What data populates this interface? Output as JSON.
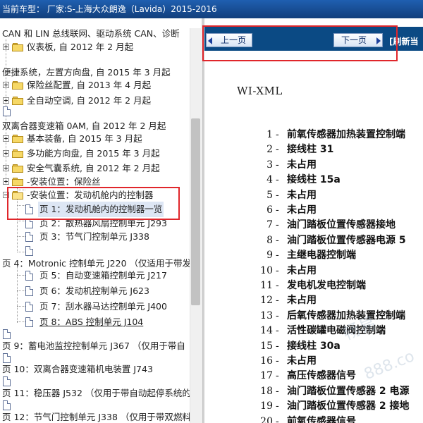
{
  "window": {
    "title": "当前车型：  厂家:S-上海大众朗逸（Lavida）2015-2016"
  },
  "tree": {
    "items": [
      {
        "label": "CAN 和 LIN 总线联网、驱动系统 CAN、诊断"
      },
      {
        "label": "仪表板, 自 2012 年 2 月起"
      },
      {
        "label": "便捷系统，左置方向盘, 自 2015 年 3 月起"
      },
      {
        "label": "保险丝配置, 自 2013 年 4 月起"
      },
      {
        "label": "全自动空调, 自 2012 年 2 月起"
      },
      {
        "label": ""
      },
      {
        "label": "双离合器变速箱 0AM, 自 2012 年 2 月起"
      },
      {
        "label": "基本装备, 自 2015 年 3 月起"
      },
      {
        "label": "多功能方向盘, 自 2015 年 3 月起"
      },
      {
        "label": "安全气囊系统, 自 2012 年 2 月起"
      },
      {
        "label": "-安装位置：保险丝"
      },
      {
        "label": "-安装位置：发动机舱内的控制器"
      },
      {
        "label": "页 1：发动机舱内的控制器一览"
      },
      {
        "label": "页 2：散热器风扇控制单元 J293"
      },
      {
        "label": "页 3：节气门控制单元 J338"
      },
      {
        "label": ""
      },
      {
        "label": "页 4：Motronic 控制单元 J220 （仅适用于带发"
      },
      {
        "label": "页 5：自动变速箱控制单元 J217"
      },
      {
        "label": "页 6：发动机控制单元 J623"
      },
      {
        "label": "页 7：刮水器马达控制单元 J400"
      },
      {
        "label": "页 8：ABS 控制单元 J104"
      },
      {
        "label": ""
      },
      {
        "label": "页 9：蓄电池监控控制单元 J367 （仅用于带自"
      },
      {
        "label": ""
      },
      {
        "label": "页 10：双离合器变速箱机电装置 J743"
      },
      {
        "label": ""
      },
      {
        "label": "页 11：稳压器 J532 （仅用于带自动起停系统的"
      },
      {
        "label": ""
      },
      {
        "label": "页 12：节气门控制单元 J338 （仅用于带双燃料"
      }
    ]
  },
  "nav": {
    "prev_label": "上一页",
    "next_label": "下一页",
    "refresh_label": "[刷新当"
  },
  "document": {
    "title": "WI-XML",
    "pins": [
      {
        "num": "1",
        "desc": "前氧传感器加热装置控制端"
      },
      {
        "num": "2",
        "desc": "接线柱 31"
      },
      {
        "num": "3",
        "desc": "未占用"
      },
      {
        "num": "4",
        "desc": "接线柱 15a"
      },
      {
        "num": "5",
        "desc": "未占用"
      },
      {
        "num": "6",
        "desc": "未占用"
      },
      {
        "num": "7",
        "desc": "油门踏板位置传感器接地"
      },
      {
        "num": "8",
        "desc": "油门踏板位置传感器电源 5"
      },
      {
        "num": "9",
        "desc": "主继电器控制端"
      },
      {
        "num": "10",
        "desc": "未占用"
      },
      {
        "num": "11",
        "desc": "发电机发电控制端"
      },
      {
        "num": "12",
        "desc": "未占用"
      },
      {
        "num": "13",
        "desc": "后氧传感器加热装置控制端"
      },
      {
        "num": "14",
        "desc": "活性碳罐电磁阀控制端"
      },
      {
        "num": "15",
        "desc": "接线柱 30a"
      },
      {
        "num": "16",
        "desc": "未占用"
      },
      {
        "num": "17",
        "desc": "高压传感器信号"
      },
      {
        "num": "18",
        "desc": "油门踏板位置传感器 2 电源"
      },
      {
        "num": "19",
        "desc": "油门踏板位置传感器 2 接地"
      },
      {
        "num": "20",
        "desc": "前氧传感器信号"
      }
    ],
    "dash": "-"
  },
  "watermark": {
    "line1": "畅易",
    "line2": "888.co"
  }
}
